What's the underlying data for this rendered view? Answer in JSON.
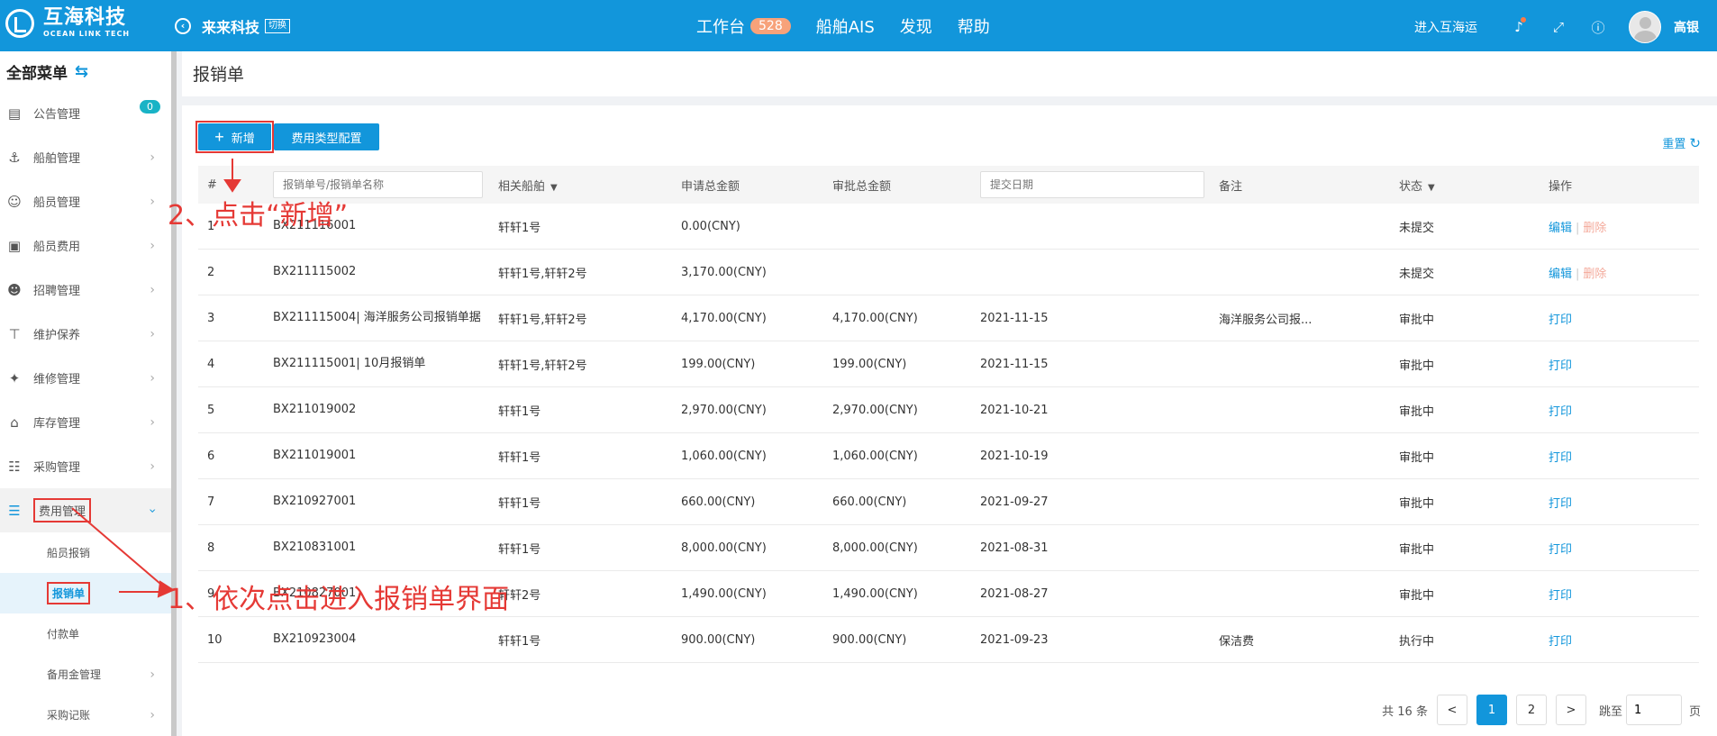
{
  "topbar": {
    "brand_cn": "互海科技",
    "brand_en": "OCEAN LINK TECH",
    "company": "来来科技",
    "switch_label": "切换",
    "nav": [
      {
        "label": "工作台",
        "badge": "528"
      },
      {
        "label": "船舶AIS"
      },
      {
        "label": "发现"
      },
      {
        "label": "帮助"
      }
    ],
    "enter_link": "进入互海运",
    "user_name": "高银"
  },
  "sidebar": {
    "title": "全部菜单",
    "items": [
      {
        "label": "公告管理",
        "badge": "0",
        "icon": "book-icon"
      },
      {
        "label": "船舶管理",
        "icon": "anchor-icon"
      },
      {
        "label": "船员管理",
        "icon": "user-icon"
      },
      {
        "label": "船员费用",
        "icon": "wallet-icon"
      },
      {
        "label": "招聘管理",
        "icon": "recruit-icon"
      },
      {
        "label": "维护保养",
        "icon": "hammer-icon"
      },
      {
        "label": "维修管理",
        "icon": "wrench-icon"
      },
      {
        "label": "库存管理",
        "icon": "home-icon"
      },
      {
        "label": "采购管理",
        "icon": "cart-icon"
      },
      {
        "label": "费用管理",
        "icon": "database-icon"
      }
    ],
    "sub_items": [
      "船员报销",
      "报销单",
      "付款单",
      "备用金管理",
      "采购记账"
    ]
  },
  "page": {
    "title": "报销单",
    "add_label": "新增",
    "type_config_label": "费用类型配置",
    "reset_label": "重置"
  },
  "table": {
    "headers": {
      "index": "#",
      "search_placeholder": "报销单号/报销单名称",
      "ship": "相关船舶",
      "apply_amount": "申请总金额",
      "approve_amount": "审批总金额",
      "date_placeholder": "提交日期",
      "remark": "备注",
      "status": "状态",
      "action": "操作"
    },
    "rows": [
      {
        "no": "1",
        "name": "BX211116001",
        "ship": "轩轩1号",
        "apply": "0.00(CNY)",
        "approve": "",
        "date": "",
        "remark": "",
        "status": "未提交",
        "action1": "编辑",
        "action2": "删除"
      },
      {
        "no": "2",
        "name": "BX211115002",
        "ship": "轩轩1号,轩轩2号",
        "apply": "3,170.00(CNY)",
        "approve": "",
        "date": "",
        "remark": "",
        "status": "未提交",
        "action1": "编辑",
        "action2": "删除"
      },
      {
        "no": "3",
        "name": "BX211115004| 海洋服务公司报销单据",
        "ship": "轩轩1号,轩轩2号",
        "apply": "4,170.00(CNY)",
        "approve": "4,170.00(CNY)",
        "date": "2021-11-15",
        "remark": "海洋服务公司报...",
        "status": "审批中",
        "action1": "打印",
        "action2": ""
      },
      {
        "no": "4",
        "name": "BX211115001| 10月报销单",
        "ship": "轩轩1号,轩轩2号",
        "apply": "199.00(CNY)",
        "approve": "199.00(CNY)",
        "date": "2021-11-15",
        "remark": "",
        "status": "审批中",
        "action1": "打印",
        "action2": ""
      },
      {
        "no": "5",
        "name": "BX211019002",
        "ship": "轩轩1号",
        "apply": "2,970.00(CNY)",
        "approve": "2,970.00(CNY)",
        "date": "2021-10-21",
        "remark": "",
        "status": "审批中",
        "action1": "打印",
        "action2": ""
      },
      {
        "no": "6",
        "name": "BX211019001",
        "ship": "轩轩1号",
        "apply": "1,060.00(CNY)",
        "approve": "1,060.00(CNY)",
        "date": "2021-10-19",
        "remark": "",
        "status": "审批中",
        "action1": "打印",
        "action2": ""
      },
      {
        "no": "7",
        "name": "BX210927001",
        "ship": "轩轩1号",
        "apply": "660.00(CNY)",
        "approve": "660.00(CNY)",
        "date": "2021-09-27",
        "remark": "",
        "status": "审批中",
        "action1": "打印",
        "action2": ""
      },
      {
        "no": "8",
        "name": "BX210831001",
        "ship": "轩轩1号",
        "apply": "8,000.00(CNY)",
        "approve": "8,000.00(CNY)",
        "date": "2021-08-31",
        "remark": "",
        "status": "审批中",
        "action1": "打印",
        "action2": ""
      },
      {
        "no": "9",
        "name": "BX210827001",
        "ship": "轩轩2号",
        "apply": "1,490.00(CNY)",
        "approve": "1,490.00(CNY)",
        "date": "2021-08-27",
        "remark": "",
        "status": "审批中",
        "action1": "打印",
        "action2": ""
      },
      {
        "no": "10",
        "name": "BX210923004",
        "ship": "轩轩1号",
        "apply": "900.00(CNY)",
        "approve": "900.00(CNY)",
        "date": "2021-09-23",
        "remark": "保洁费",
        "status": "执行中",
        "action1": "打印",
        "action2": ""
      }
    ]
  },
  "pager": {
    "total": "共 16 条",
    "prev": "<",
    "pages": [
      "1",
      "2"
    ],
    "next": ">",
    "goto_label": "跳至",
    "goto_value": "1",
    "page_unit": "页"
  },
  "annotations": {
    "step1": "1、依次点击进入报销单界面",
    "step2": "2、点击“新增”"
  },
  "colors": {
    "brand": "#1296db",
    "annotation": "#e53935",
    "badge": "#f7a27a"
  }
}
